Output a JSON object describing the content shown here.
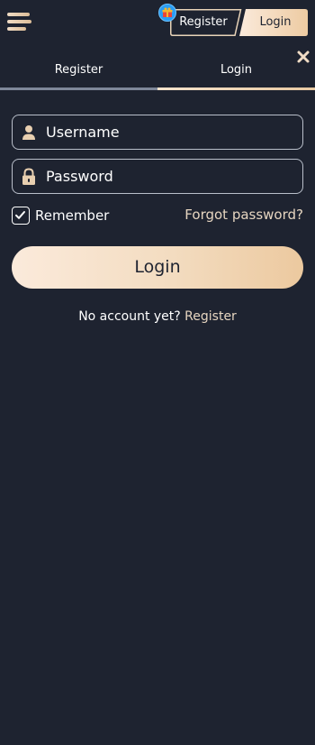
{
  "colors": {
    "background": "#1e2330",
    "accent_gold": "#ecc99f",
    "link_gold": "#e6d5c0",
    "input_border": "#b9bfca"
  },
  "header": {
    "menu_icon": "hamburger-menu-icon",
    "gift_icon": "gift-icon",
    "register_label": "Register",
    "login_label": "Login"
  },
  "tabs": [
    {
      "label": "Register",
      "active": false
    },
    {
      "label": "Login",
      "active": true
    }
  ],
  "close_icon": "close-icon",
  "form": {
    "username": {
      "placeholder": "Username",
      "value": "",
      "icon": "user-icon"
    },
    "password": {
      "placeholder": "Password",
      "value": "",
      "icon": "lock-icon"
    },
    "remember_label": "Remember",
    "remember_checked": true,
    "forgot_label": "Forgot password?",
    "submit_label": "Login"
  },
  "footer": {
    "question": "No account yet?",
    "register_link": "Register"
  }
}
